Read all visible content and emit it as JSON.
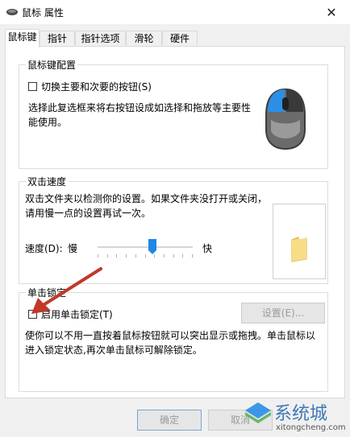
{
  "window": {
    "title": "鼠标 属性",
    "close_glyph": "✕"
  },
  "tabs": [
    {
      "label": "鼠标键",
      "active": true
    },
    {
      "label": "指针",
      "active": false
    },
    {
      "label": "指针选项",
      "active": false
    },
    {
      "label": "滑轮",
      "active": false
    },
    {
      "label": "硬件",
      "active": false
    }
  ],
  "button_config": {
    "title": "鼠标键配置",
    "switch_label": "切换主要和次要的按钮(S)",
    "switch_checked": false,
    "description": "选择此复选框来将右按钮设成如选择和拖放等主要性能使用。"
  },
  "double_click": {
    "title": "双击速度",
    "description": "双击文件夹以检测你的设置。如果文件夹没打开或关闭，请用慢一点的设置再试一次。",
    "speed_label": "速度(D):",
    "slow_label": "慢",
    "fast_label": "快",
    "speed_level": 0.58
  },
  "click_lock": {
    "title": "单击锁定",
    "enable_label": "启用单击锁定(T)",
    "enable_checked": false,
    "settings_button": "设置(E)...",
    "description": "使你可以不用一直按着鼠标按钮就可以突出显示或拖拽。单击鼠标以进入锁定状态,再次单击鼠标可解除锁定。"
  },
  "footer": {
    "ok_button": "确定",
    "cancel_button": "取消"
  },
  "watermark": {
    "text": "系统城",
    "url": "xitongcheng.com"
  },
  "colors": {
    "accent": "#1e88e5",
    "arrow": "#c0392b",
    "folder": "#f3d46b"
  }
}
